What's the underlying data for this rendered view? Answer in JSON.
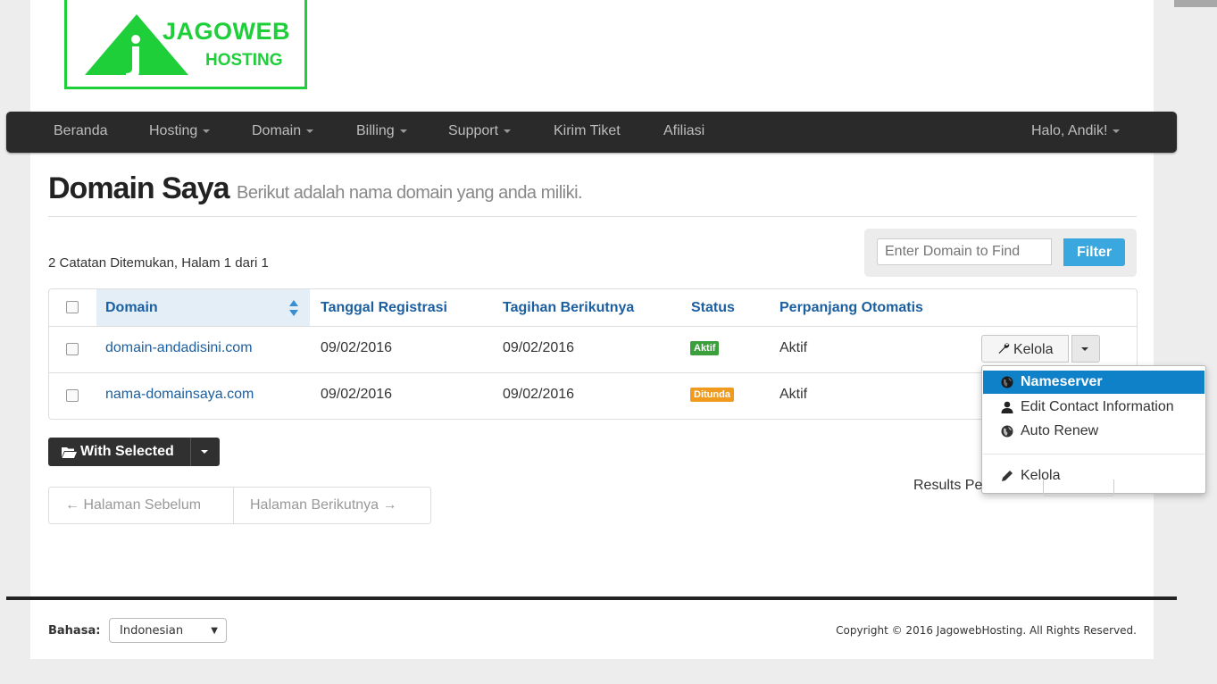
{
  "logo": {
    "line1": "JAGOWEB",
    "line2": "HOSTING",
    "color": "#1fcf3a"
  },
  "navbar": {
    "items": [
      {
        "label": "Beranda"
      },
      {
        "label": "Hosting"
      },
      {
        "label": "Domain"
      },
      {
        "label": "Billing"
      },
      {
        "label": "Support"
      },
      {
        "label": "Kirim Tiket"
      },
      {
        "label": "Afiliasi"
      }
    ],
    "user": "Halo, Andik!"
  },
  "page": {
    "title": "Domain Saya",
    "subtitle": "Berikut adalah nama domain yang anda miliki.",
    "records": "2 Catatan Ditemukan, Halam 1 dari 1"
  },
  "filter": {
    "placeholder": "Enter Domain to Find",
    "button": "Filter"
  },
  "table": {
    "headers": [
      "Domain",
      "Tanggal Registrasi",
      "Tagihan Berikutnya",
      "Status",
      "Perpanjang Otomatis"
    ],
    "rows": [
      {
        "domain": "domain-andadisini.com",
        "reg": "09/02/2016",
        "next": "09/02/2016",
        "status": "Aktif",
        "auto": "Aktif"
      },
      {
        "domain": "nama-domainsaya.com",
        "reg": "09/02/2016",
        "next": "09/02/2016",
        "status": "Ditunda",
        "auto": "Aktif"
      }
    ]
  },
  "manage": {
    "button": "Kelola",
    "menu": [
      "Nameserver",
      "Edit Contact Information",
      "Auto Renew",
      "Kelola"
    ]
  },
  "bulk": {
    "label": "With Selected"
  },
  "pagination": {
    "prev": "← Halaman Sebelum",
    "next": "Halaman Berikutnya →"
  },
  "results": {
    "label": "Results Pe"
  },
  "footer": {
    "lang_label": "Bahasa:",
    "lang_value": "Indonesian",
    "copyright": "Copyright © 2016 JagowebHosting. All Rights Reserved."
  },
  "colors": {
    "accent": "#3aa7de",
    "link": "#1c5fa0",
    "active": "#0f81c8",
    "status_active": "#3b9f3b",
    "status_pending": "#f09a1e"
  }
}
